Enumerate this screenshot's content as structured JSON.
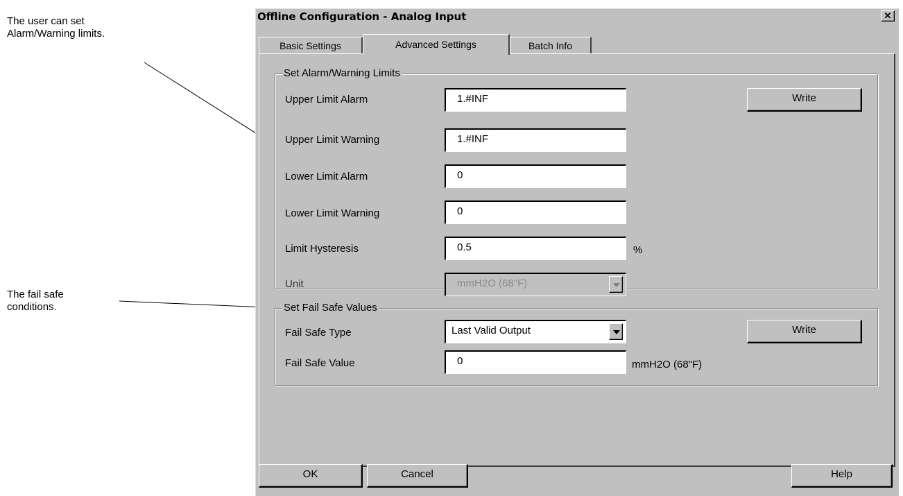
{
  "annotations": {
    "alarm_line1": "The user can set",
    "alarm_line2": "Alarm/Warning limits.",
    "failsafe_line1": "The fail safe",
    "failsafe_line2": "conditions."
  },
  "dialog": {
    "title": "Offline Configuration - Analog Input",
    "close_glyph": "✕",
    "tabs": [
      "Basic Settings",
      "Advanced Settings",
      "Batch Info"
    ],
    "active_tab": "Advanced Settings"
  },
  "alarm_group": {
    "legend": "Set Alarm/Warning Limits",
    "upper_alarm": {
      "label": "Upper Limit Alarm",
      "value": "1.#INF"
    },
    "upper_warning": {
      "label": "Upper Limit Warning",
      "value": "1.#INF"
    },
    "lower_alarm": {
      "label": "Lower Limit Alarm",
      "value": "0"
    },
    "lower_warning": {
      "label": "Lower Limit Warning",
      "value": "0"
    },
    "hysteresis": {
      "label": "Limit Hysteresis",
      "value": "0.5",
      "unit": "%"
    },
    "unit": {
      "label": "Unit",
      "value": "mmH2O (68\"F)",
      "disabled": true
    },
    "write_label": "Write"
  },
  "failsafe_group": {
    "legend": "Set Fail Safe Values",
    "type": {
      "label": "Fail Safe Type",
      "value": "Last Valid Output"
    },
    "value": {
      "label": "Fail Safe Value",
      "value": "0",
      "unit": "mmH2O (68\"F)"
    },
    "write_label": "Write"
  },
  "footer": {
    "ok": "OK",
    "cancel": "Cancel",
    "help": "Help"
  },
  "colors": {
    "face": "#c0c0c0",
    "shadow": "#808080",
    "highlight": "#ffffff"
  }
}
